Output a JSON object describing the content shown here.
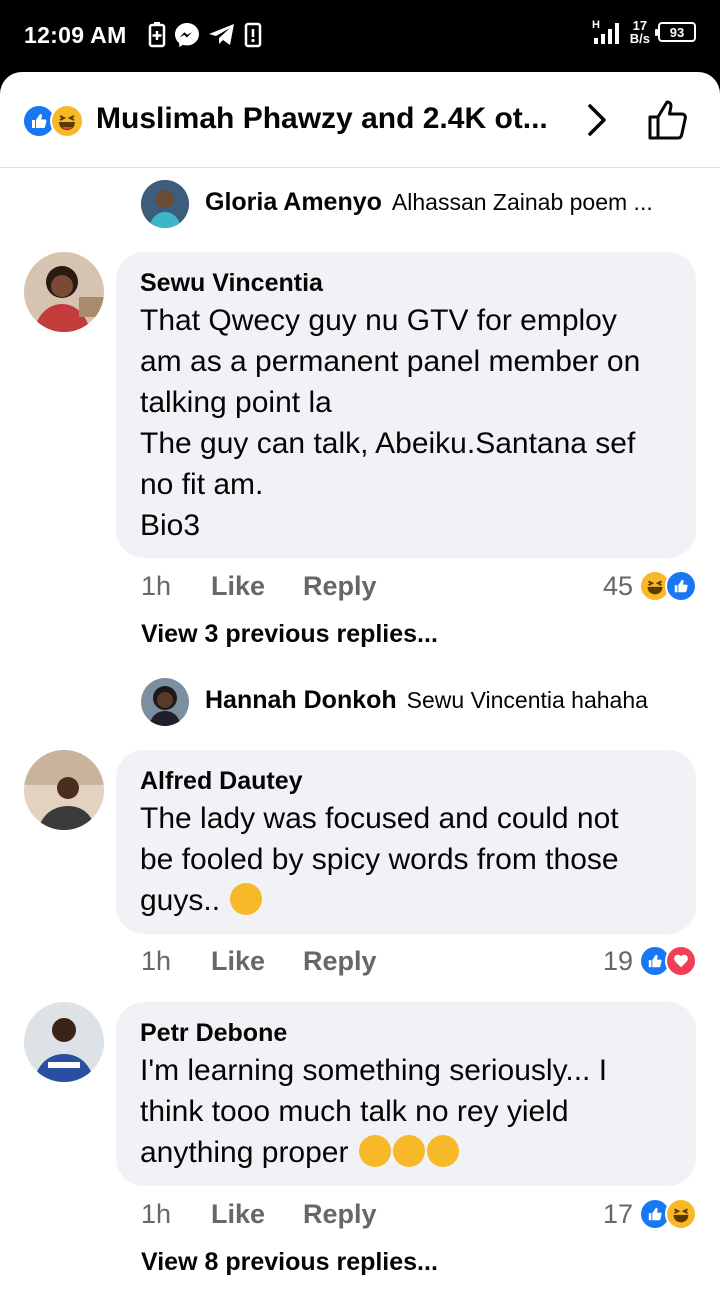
{
  "status_bar": {
    "time": "12:09 AM",
    "signal_label": "H",
    "net_speed_value": "17",
    "net_speed_unit": "B/s",
    "battery": "93"
  },
  "header": {
    "title": "Muslimah Phawzy and 2.4K ot...",
    "reactions": [
      "like",
      "haha"
    ]
  },
  "comments": [
    {
      "type": "reply",
      "name": "Gloria Amenyo",
      "text": "Alhassan Zainab poem ...",
      "avatar_color": "#4a6a8a"
    },
    {
      "type": "comment",
      "author": "Sewu Vincentia",
      "text": "That Qwecy guy nu GTV for employ\nam as a permanent panel member on\ntalking point la\nThe guy can talk, Abeiku.Santana sef\nno fit am.\nBio3",
      "time": "1h",
      "like": "Like",
      "reply": "Reply",
      "reaction_count": "45",
      "reactions": [
        "haha",
        "like"
      ],
      "avatar_color": "#8b3a3a"
    },
    {
      "type": "view_previous",
      "text": "View 3 previous replies..."
    },
    {
      "type": "reply",
      "name": "Hannah Donkoh",
      "text": "Sewu Vincentia hahaha",
      "avatar_color": "#2d2d3a"
    },
    {
      "type": "comment",
      "author": "Alfred Dautey",
      "text": "The lady was focused and could not\nbe fooled by spicy words from those\nguys..",
      "time": "1h",
      "like": "Like",
      "reply": "Reply",
      "reaction_count": "19",
      "reactions": [
        "like",
        "love"
      ],
      "avatar_color": "#b89a7a"
    },
    {
      "type": "comment",
      "author": "Petr Debone",
      "text": "I'm learning something seriously... I\nthink tooo much talk no rey yield\nanything proper",
      "time": "1h",
      "like": "Like",
      "reply": "Reply",
      "reaction_count": "17",
      "reactions": [
        "like",
        "haha"
      ],
      "avatar_color": "#2a4fa0"
    },
    {
      "type": "view_previous",
      "text": "View 8 previous replies..."
    }
  ]
}
